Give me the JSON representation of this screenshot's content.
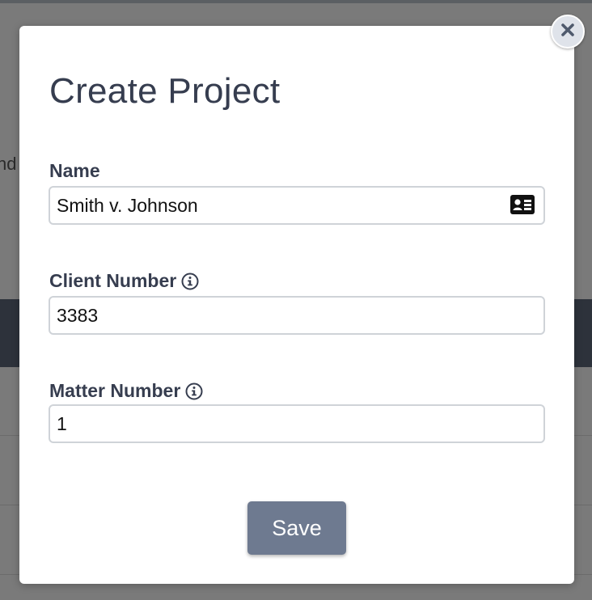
{
  "background": {
    "partial_text": "nd"
  },
  "modal": {
    "title": "Create Project",
    "close_icon": "close-icon",
    "fields": {
      "name": {
        "label": "Name",
        "value": "Smith v. Johnson",
        "icon": "contact-card-icon"
      },
      "client_number": {
        "label": "Client Number",
        "value": "3383",
        "icon": "info-icon"
      },
      "matter_number": {
        "label": "Matter Number",
        "value": "1",
        "icon": "info-icon"
      }
    },
    "save_label": "Save"
  },
  "colors": {
    "title_text": "#363d4f",
    "save_button": "#6e7a90",
    "close_button": "#dfe3ea",
    "backdrop": "#7a7a7a"
  }
}
